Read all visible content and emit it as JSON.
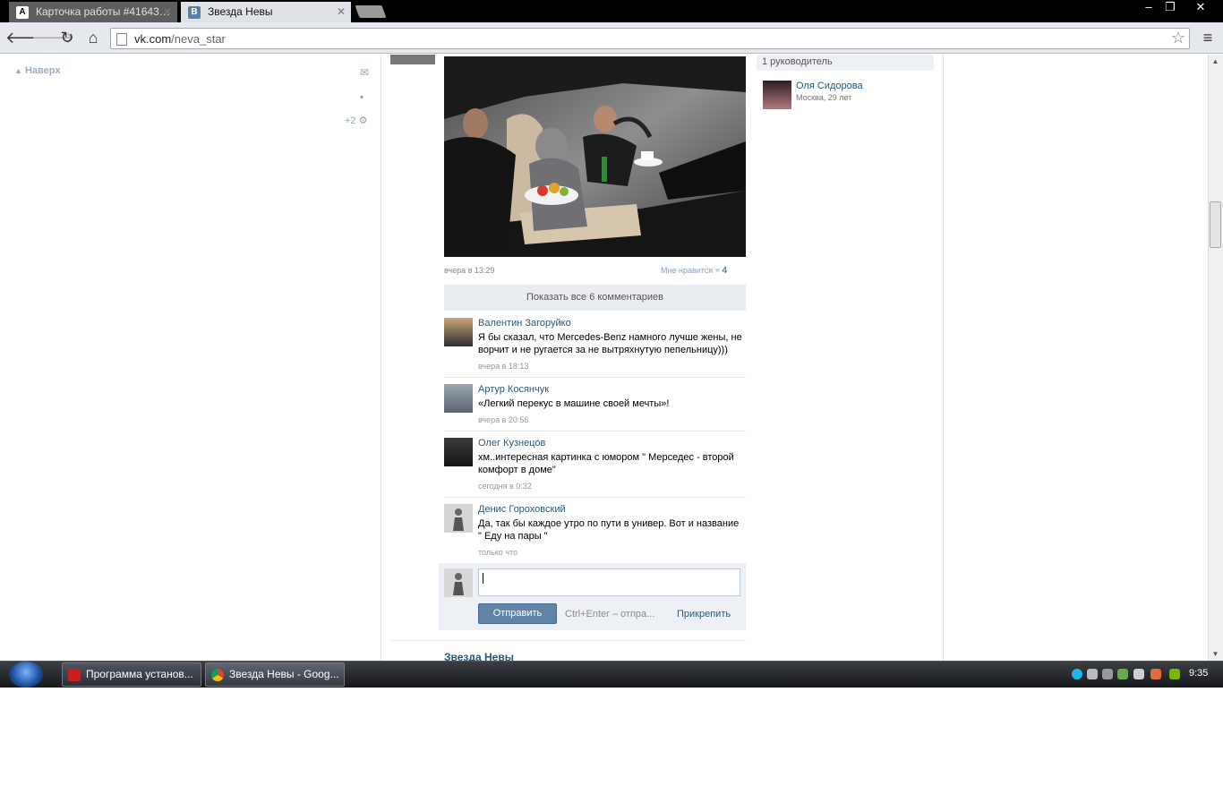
{
  "browser": {
    "tabs": [
      {
        "label": "Карточка работы #41643…",
        "favicon": "А",
        "active": false
      },
      {
        "label": "Звезда Невы",
        "favicon": "В",
        "active": true
      }
    ],
    "url_host": "vk.com",
    "url_path": "/neva_star",
    "window_buttons": [
      "minimize",
      "restore",
      "close"
    ]
  },
  "vk": {
    "back_to_top": "Наверх",
    "counter": "+2",
    "post": {
      "time": "вчера в 13:29",
      "like_label": "Мне нравится",
      "like_count": "4",
      "show_all_comments": "Показать все 6 комментариев"
    },
    "comments": [
      {
        "author": "Валентин Загоруйко",
        "text": "Я бы сказал, что Mercedes-Benz намного лучше жены, не ворчит и не ругается за не вытряхнутую пепельницу)))",
        "time": "вчера в 18:13"
      },
      {
        "author": "Артур Косянчук",
        "text": "«Легкий перекус в машине своей мечты»!",
        "time": "вчера в 20:56"
      },
      {
        "author": "Олег Кузнецов",
        "text": "хм..интересная картинка с юмором \" Мерседес - второй комфорт в доме\"",
        "time": "сегодня в 0:32"
      },
      {
        "author": "Денис Гороховский",
        "text": "Да, так бы каждое утро по пути в универ. Вот и название \" Еду на пары \"",
        "time": "только что"
      }
    ],
    "reply": {
      "send": "Отправить",
      "hint": "Ctrl+Enter – отпра...",
      "attach": "Прикрепить"
    },
    "next_post_title": "Звезда Невы",
    "sidebar_right": {
      "leaders_header": "1 руководитель",
      "leader_name": "Оля Сидорова",
      "leader_info": "Москва, 29 лет"
    }
  },
  "taskbar": {
    "tasks": [
      {
        "label": "Программа установ...",
        "icon": "flash-installer-icon"
      },
      {
        "label": "Звезда Невы - Goog...",
        "icon": "chrome-icon"
      }
    ],
    "clock": "9:35"
  }
}
